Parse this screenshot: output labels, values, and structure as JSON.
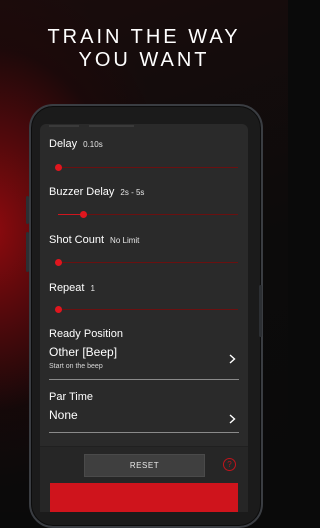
{
  "headline": {
    "line1": "TRAIN THE WAY",
    "line2": "YOU WANT"
  },
  "settings": [
    {
      "title": "Delay",
      "value": "0.10s",
      "level": 0.0
    },
    {
      "title": "Buzzer Delay",
      "value": "2s - 5s",
      "level_low": 0.0,
      "level_high": 0.14
    },
    {
      "title": "Shot Count",
      "value": "No Limit",
      "level": 0.0
    },
    {
      "title": "Repeat",
      "value": "1",
      "level": 0.0
    }
  ],
  "ready_position": {
    "title": "Ready Position",
    "value": "Other [Beep]",
    "description": "Start on the beep"
  },
  "par_time": {
    "title": "Par Time",
    "value": "None"
  },
  "footer": {
    "reset_label": "RESET",
    "help_glyph": "?"
  },
  "colors": {
    "accent": "#D0161E",
    "screen_bg": "#2A2A2A",
    "track": "#6A1010"
  },
  "icons": {
    "chevron": "chevron-right-icon",
    "help": "help-circle-icon"
  }
}
